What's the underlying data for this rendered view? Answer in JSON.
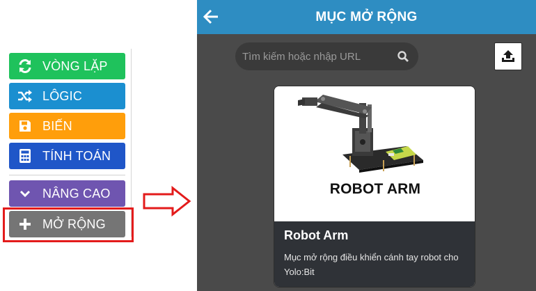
{
  "toolbox": {
    "categories": [
      {
        "label": "VÒNG LẶP",
        "icon": "loop-icon",
        "color": "#1fc25c"
      },
      {
        "label": "LÔGIC",
        "icon": "shuffle-icon",
        "color": "#1b8fd0"
      },
      {
        "label": "BIẾN",
        "icon": "save-icon",
        "color": "#ff9e0b"
      },
      {
        "label": "TÍNH TOÁN",
        "icon": "calculator-icon",
        "color": "#1f56c8"
      },
      {
        "label": "NÂNG CAO",
        "icon": "chevron-down-icon",
        "color": "#6f55b0"
      },
      {
        "label": "MỞ RỘNG",
        "icon": "plus-icon",
        "color": "#757575"
      }
    ],
    "highlight_color": "#e31b1b"
  },
  "arrow": {
    "color": "#e31b1b"
  },
  "panel": {
    "title": "MỤC MỞ RỘNG",
    "back_icon": "arrow-left-icon",
    "header_color": "#2e8dc2",
    "search": {
      "placeholder": "Tìm kiếm hoặc nhập URL",
      "value": ""
    },
    "upload_icon": "upload-icon",
    "extension": {
      "image_label": "ROBOT ARM",
      "title": "Robot Arm",
      "description": "Mục mở rộng điều khiển cánh tay robot cho Yolo:Bit"
    }
  }
}
